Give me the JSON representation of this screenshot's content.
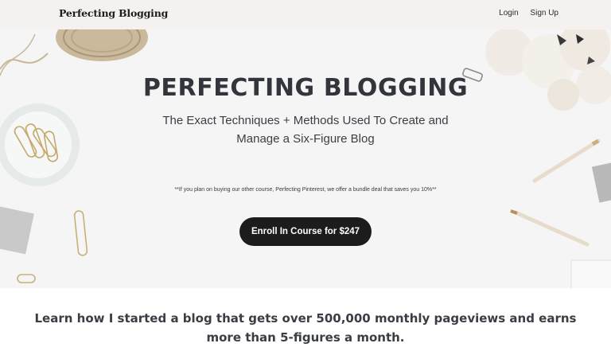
{
  "header": {
    "logo": "Perfecting Blogging",
    "nav": {
      "login": "Login",
      "signup": "Sign Up"
    }
  },
  "hero": {
    "title": "PERFECTING BLOGGING",
    "subtitle": "The Exact Techniques + Methods Used To Create and Manage a Six-Figure Blog",
    "note": "**If you plan on buying our other course, Perfecting Pinterest, we offer a bundle deal that saves you 10%**",
    "cta_label": "Enroll In Course for $247"
  },
  "intro": {
    "line1": "Learn how I started a blog that gets over 500,000 monthly pageviews and earns",
    "line2": "more than 5-figures a month."
  }
}
